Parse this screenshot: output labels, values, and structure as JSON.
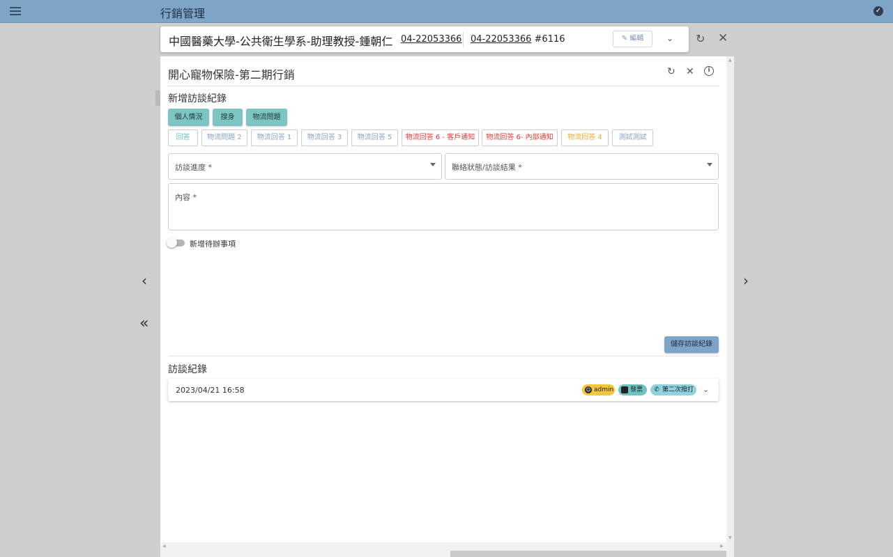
{
  "app": {
    "title": "行銷管理"
  },
  "contact": {
    "name": "中國醫藥大學-公共衛生學系-助理教授-鍾朝仁",
    "phone_primary": "04-22053366",
    "phone_secondary": "04-22053366",
    "extension": " #6116",
    "edit_label": "編輯"
  },
  "campaign": {
    "title": "開心寵物保險-第二期行銷"
  },
  "new_record": {
    "heading": "新增訪談紀錄",
    "quick_tags": [
      "個人情況",
      "搜身",
      "物流問題"
    ],
    "answer_tags": [
      {
        "label": "回答",
        "color": "#6cbfbf"
      },
      {
        "label": "物流問題 2",
        "color": "#8aa3c2"
      },
      {
        "label": "物流回答 1",
        "color": "#8aa3c2"
      },
      {
        "label": "物流回答 3",
        "color": "#8aa3c2"
      },
      {
        "label": "物流回答 5",
        "color": "#8aa3c2"
      },
      {
        "label": "物流回答 6 - 客戶通知",
        "color": "#e53935"
      },
      {
        "label": "物流回答 6- 內部通知",
        "color": "#e53935"
      },
      {
        "label": "物流回答 4",
        "color": "#f0a830"
      },
      {
        "label": "測試測試",
        "color": "#8aa3c2"
      }
    ],
    "progress_label": "訪談進度 *",
    "status_label": "聯絡狀態/訪談結果 *",
    "content_label": "內容 *",
    "todo_toggle_label": "新增待辦事項",
    "save_label": "儲存訪談紀錄"
  },
  "records": {
    "heading": "訪談紀錄",
    "items": [
      {
        "timestamp": "2023/04/21 16:58",
        "chips": [
          {
            "label": "admin",
            "color": "#f5c542",
            "icon": "face-icon"
          },
          {
            "label": "發票",
            "color": "#6cc5c5",
            "icon": "label-icon"
          },
          {
            "label": "第二次撥打",
            "color": "#8fd3e0",
            "icon": "phone-icon"
          }
        ]
      }
    ]
  },
  "colors": {
    "topbar": "#7ea5c8",
    "teal_button": "#7ec4c3",
    "save_button": "#7ea5c8"
  }
}
